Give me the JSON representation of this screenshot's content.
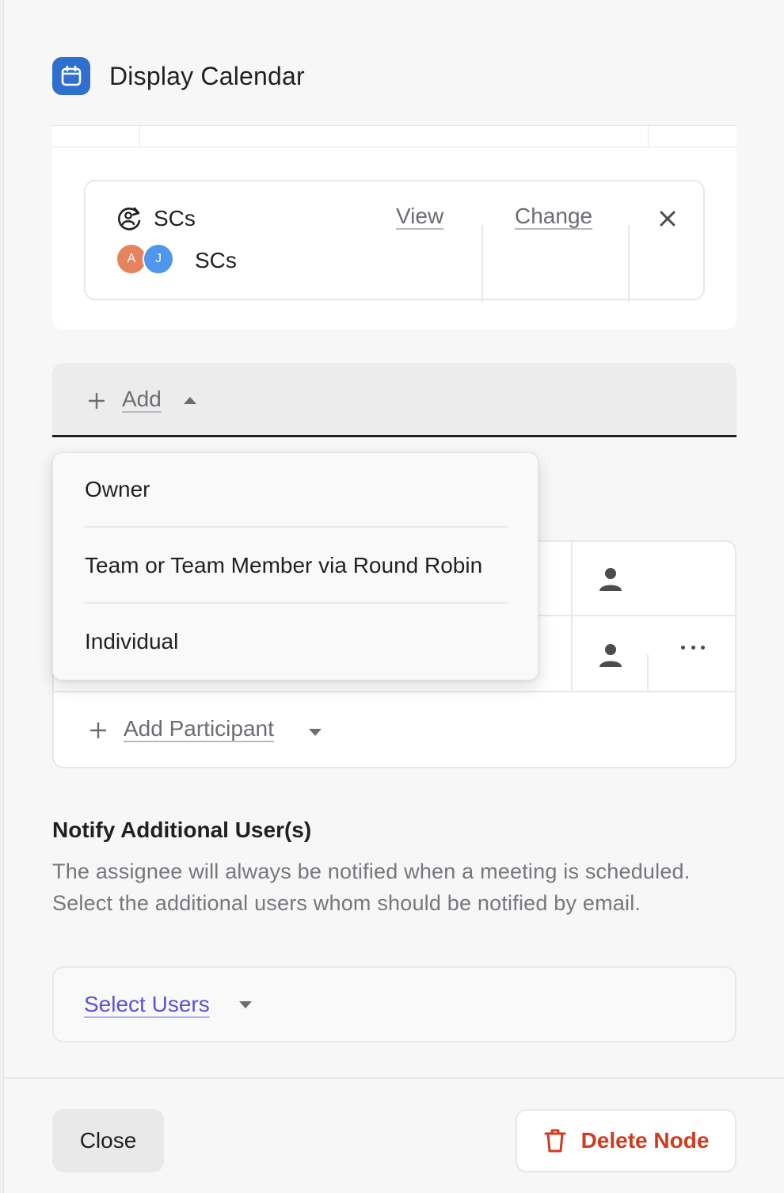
{
  "header": {
    "title": "Display Calendar",
    "icon": "calendar-icon"
  },
  "assignment": {
    "icon": "round-robin-user-icon",
    "title": "SCs",
    "avatars": [
      "A",
      "J"
    ],
    "subtitle": "SCs",
    "view_label": "View",
    "change_label": "Change"
  },
  "add_bar": {
    "label": "Add",
    "expanded": true
  },
  "add_menu": {
    "items": [
      "Owner",
      "Team or Team Member via Round Robin",
      "Individual"
    ]
  },
  "participants": {
    "add_label": "Add Participant"
  },
  "notify": {
    "title": "Notify Additional User(s)",
    "description": "The assignee will always be notified when a meeting is scheduled. Select the additional users whom should be notified by email.",
    "select_label": "Select Users"
  },
  "footer": {
    "close_label": "Close",
    "delete_label": "Delete Node"
  },
  "colors": {
    "calendar_icon_bg": "#2f6fd0",
    "avatar_a": "#e5835c",
    "avatar_j": "#4f96ed",
    "link_purple": "#5b4fe0",
    "danger": "#d03a1f"
  }
}
